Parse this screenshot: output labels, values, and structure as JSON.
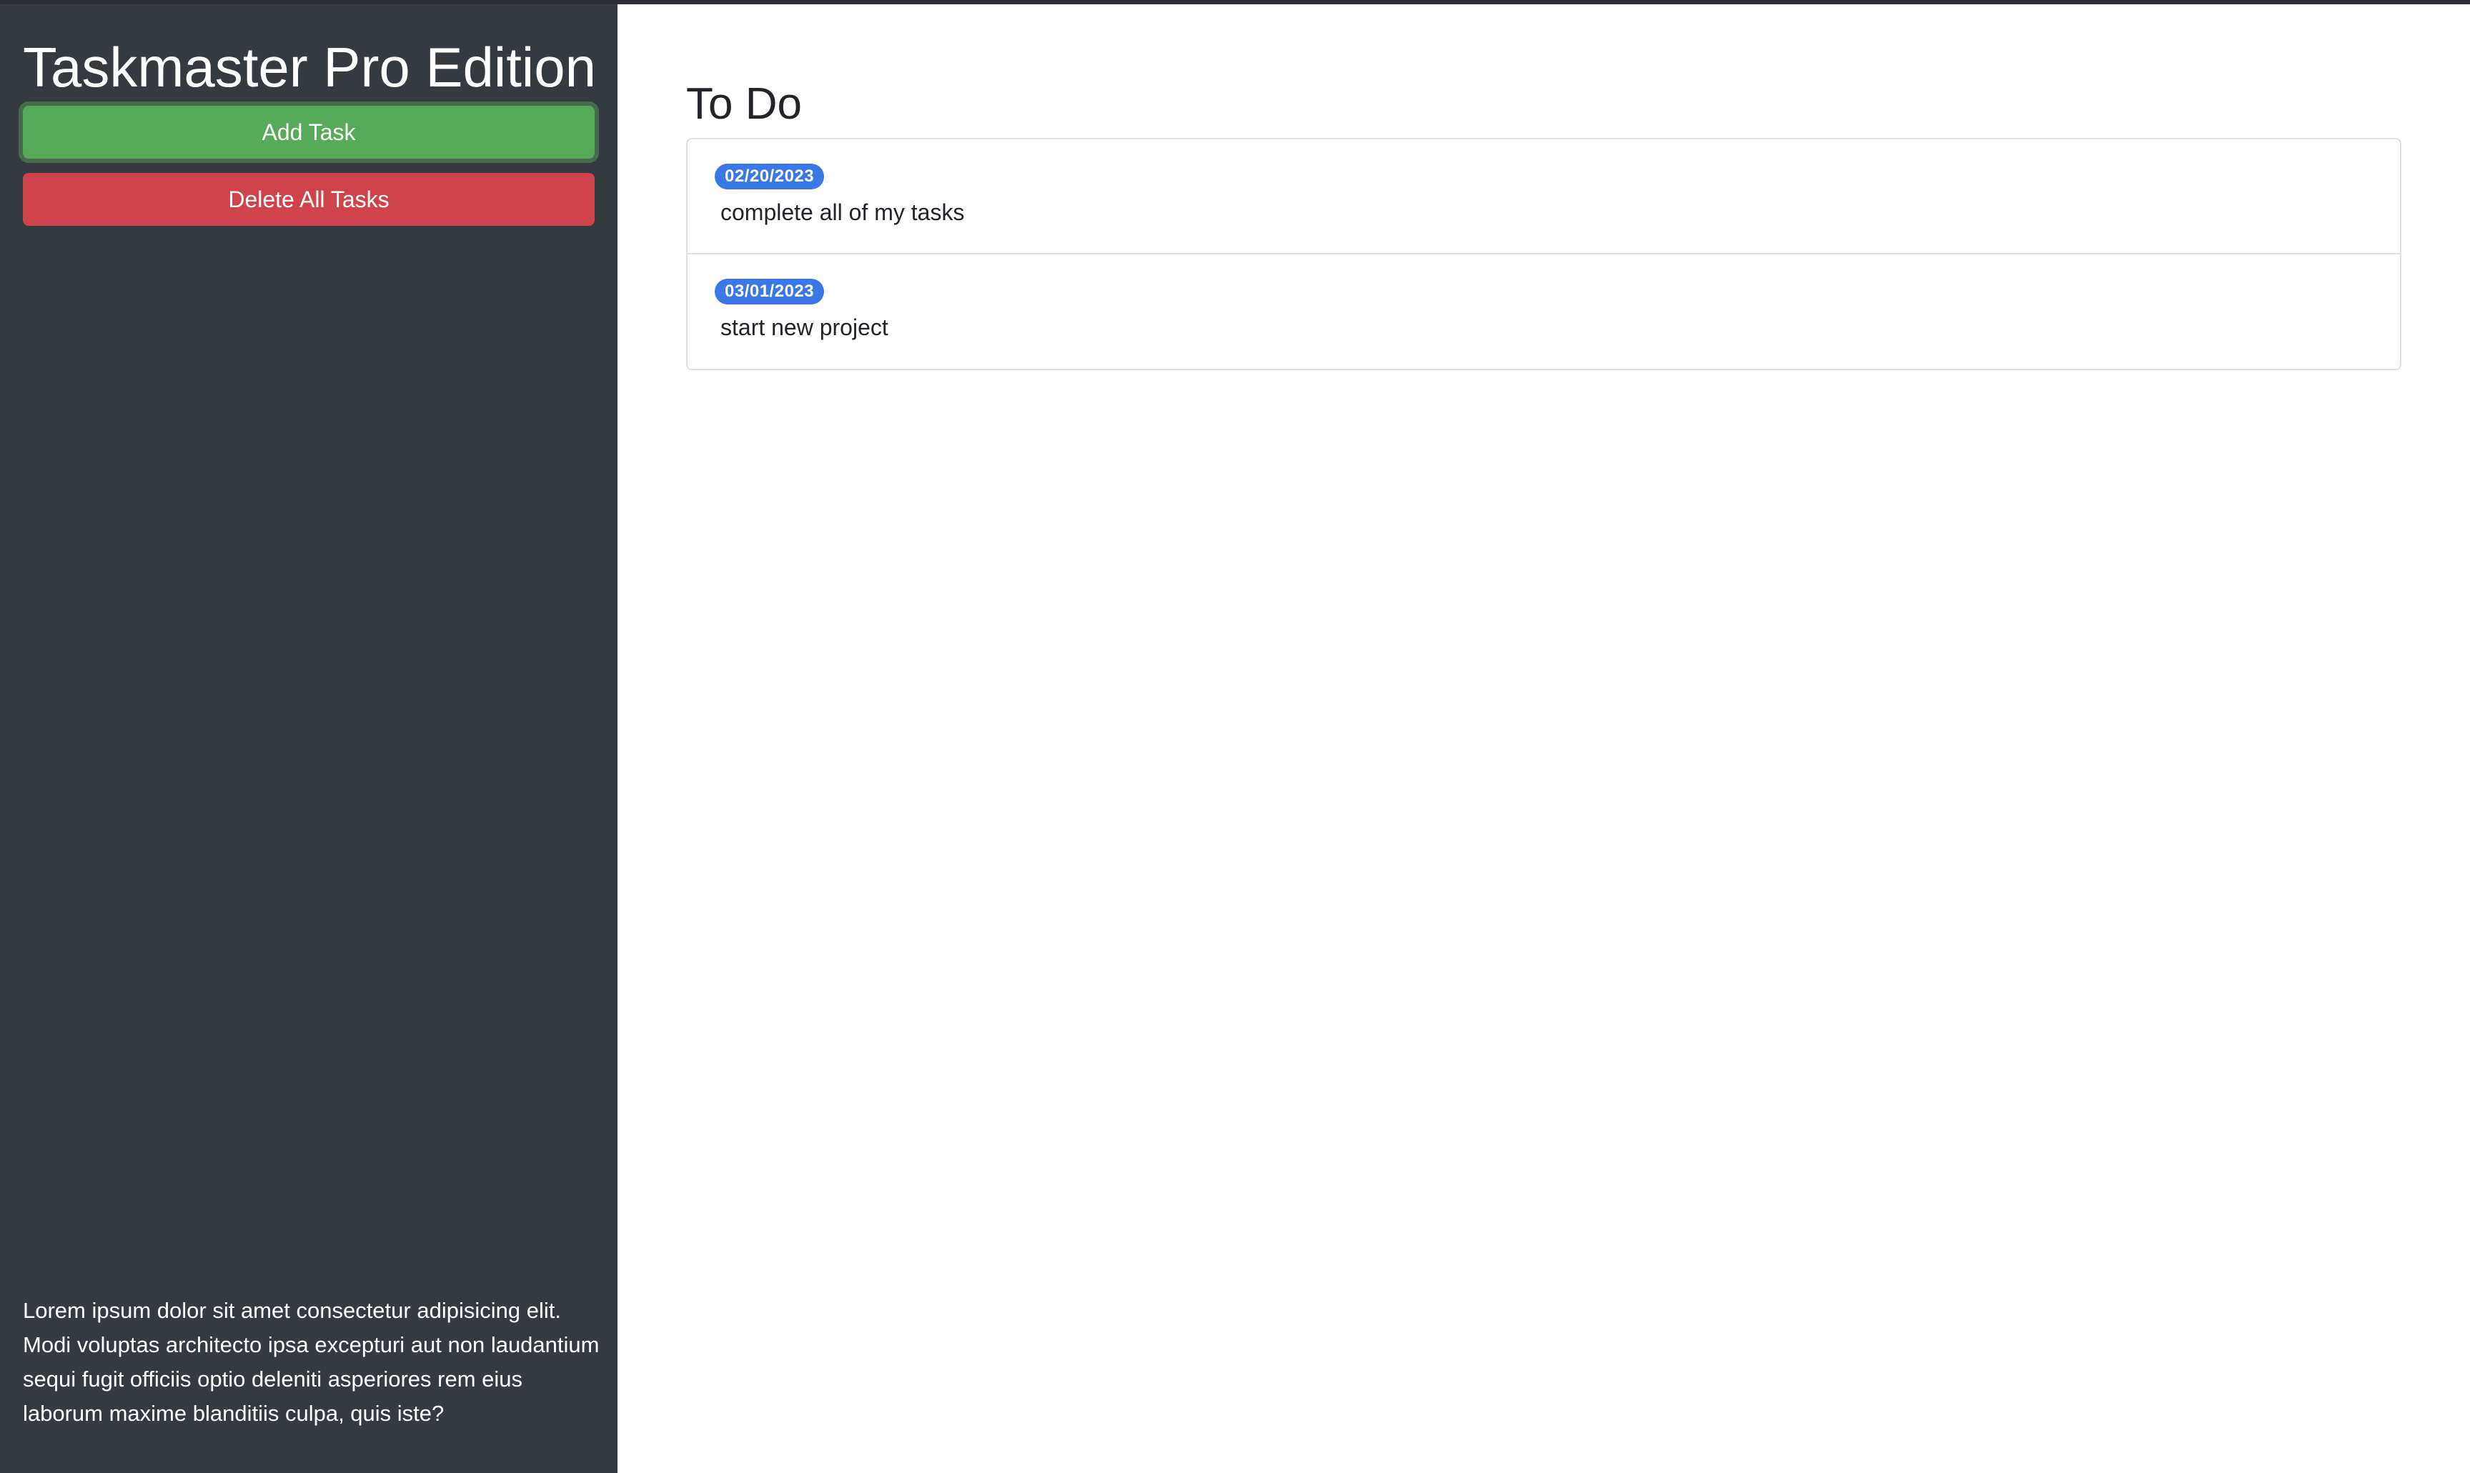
{
  "sidebar": {
    "title": "Taskmaster Pro Edition",
    "add_button": "Add Task",
    "delete_button": "Delete All Tasks",
    "description": "Lorem ipsum dolor sit amet consectetur adipisicing elit. Modi voluptas architecto ipsa excepturi aut non laudantium sequi fugit officiis optio deleniti asperiores rem eius laborum maxime blanditiis culpa, quis iste?"
  },
  "main": {
    "section_title": "To Do",
    "tasks": [
      {
        "date": "02/20/2023",
        "text": "complete all of my tasks"
      },
      {
        "date": "03/01/2023",
        "text": "start new project"
      }
    ]
  },
  "colors": {
    "sidebar_bg": "#343a40",
    "add_button": "#57aa57",
    "delete_button": "#cf444b",
    "badge": "#3a78e7"
  }
}
